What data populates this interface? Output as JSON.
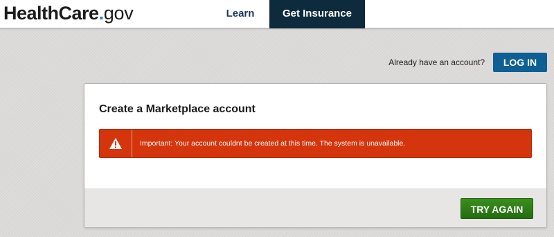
{
  "header": {
    "logo_main": "HealthCare",
    "logo_dot": ".",
    "logo_gov": "gov",
    "nav": {
      "learn": "Learn",
      "get_insurance": "Get Insurance"
    }
  },
  "account": {
    "prompt": "Already have an account?",
    "login_label": "LOG IN"
  },
  "card": {
    "title": "Create a Marketplace account",
    "alert": {
      "icon": "warning-icon",
      "message": "Important: Your account couldnt be created at this time. The system is unavailable."
    },
    "try_again_label": "TRY AGAIN"
  },
  "colors": {
    "nav_active_bg": "#0e2a3d",
    "login_button": "#0d5f94",
    "alert_bg": "#d5350c",
    "try_again_button": "#2c7a16",
    "page_bg": "#dcdbd9"
  }
}
